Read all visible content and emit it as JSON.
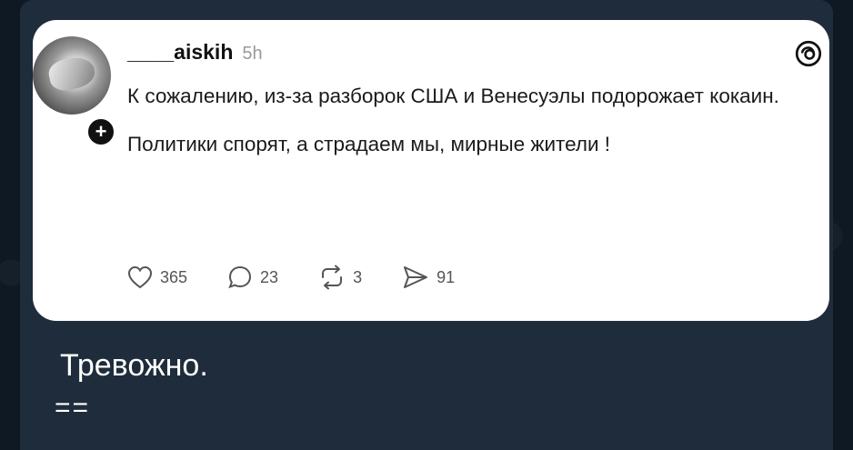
{
  "post": {
    "username": "____aiskih",
    "time": "5h",
    "paragraphs": [
      "К сожалению, из-за разборок США и Венесуэлы подорожает кокаин.",
      "Политики спорят, а страдаем мы, мирные жители !"
    ],
    "stats": {
      "likes": "365",
      "replies": "23",
      "reposts": "3",
      "shares": "91"
    }
  },
  "message": {
    "caption": "Тревожно.",
    "extra": "=="
  },
  "icons": {
    "avatar_badge": "plus-icon",
    "brand": "threads-logo-icon",
    "like": "heart-icon",
    "reply": "comment-icon",
    "repost": "repost-icon",
    "share": "send-icon"
  },
  "colors": {
    "chat_background": "#0f1924",
    "bubble": "#1f2c3b",
    "card": "#ffffff",
    "text": "#1a1a1a",
    "muted": "#9a9a9a"
  }
}
